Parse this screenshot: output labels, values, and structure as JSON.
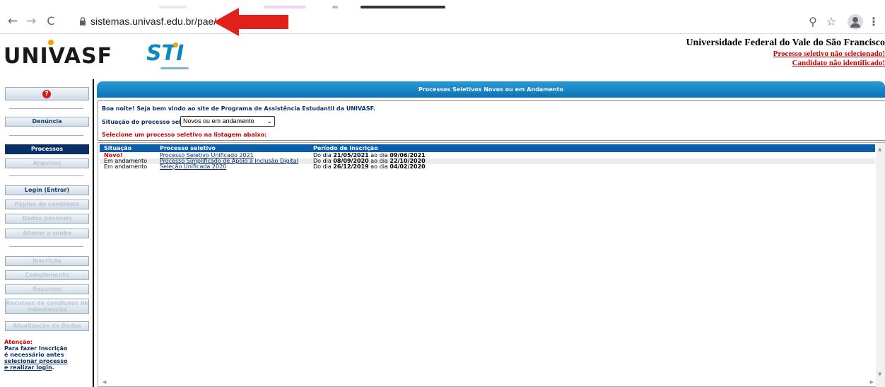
{
  "browser": {
    "url": "sistemas.univasf.edu.br/pae/",
    "icons": {
      "back": "←",
      "forward": "→",
      "reload": "C",
      "zoom": "⚲",
      "star": "☆",
      "menu": "⋮"
    }
  },
  "site": {
    "logo_text": "UNIVASF",
    "sti_logo_text": "STI",
    "university_name": "Universidade Federal do Vale do São Francisco",
    "process_status": "Processo seletivo não selecionado!",
    "candidate_status": "Candidato não identificado!"
  },
  "sidebar": {
    "help_icon": "?",
    "denuncia": "Denúncia",
    "processos": "Processos",
    "arquivos": "Arquivos",
    "login": "Login (Entrar)",
    "pagina_candidato": "Página do candidato",
    "dados_pessoais": "Dados pessoais",
    "alterar_senha": "Alterar a senha",
    "inscricao": "Inscrição",
    "complemento": "Complemento",
    "recursos": "Recursos",
    "recursos_condicoes_1": "Recursos de condições de",
    "recursos_condicoes_2": "manutenção",
    "atualizacao_dados": "Atualização de Dados",
    "attention": {
      "title": "Atenção:",
      "line1": "Para fazer Inscrição",
      "line2": "é necessário antes",
      "link1": "selecionar processo",
      "link2": "e realizar login",
      "tail": "."
    }
  },
  "main": {
    "title": "Processos Seletivos Novos ou em Andamento",
    "welcome": "Boa noite! Seja bem vindo ao site de Programa de Assistência Estudantil da UNIVASF.",
    "status_label": "Situação do processo seletivo:",
    "status_value": "Novos ou em andamento",
    "hint": "Selecione um processo seletivo na listagem abaixo:",
    "columns": {
      "situacao": "Situação",
      "processo": "Processo seletivo",
      "periodo": "Período de inscrição"
    },
    "rows": [
      {
        "situacao": "Novo!",
        "processo": "Processo Seletivo Unificado 2021",
        "prefix": "Do dia",
        "start": "21/05/2021",
        "mid": "ao dia",
        "end": "09/06/2021"
      },
      {
        "situacao": "Em andamento",
        "processo": "Processo Simplificado de Apoio a Inclusão Digital",
        "prefix": "Do dia",
        "start": "08/09/2020",
        "mid": "ao dia",
        "end": "22/10/2020"
      },
      {
        "situacao": "Em andamento",
        "processo": "Seleção Unificada 2020",
        "prefix": "Do dia",
        "start": "26/12/2019",
        "mid": "ao dia",
        "end": "04/02/2020"
      }
    ]
  },
  "colors": {
    "accent_blue": "#0b72b5",
    "nav_dark": "#0a2f66",
    "alert_red": "#d00000",
    "annotation_arrow": "#e0201b"
  }
}
